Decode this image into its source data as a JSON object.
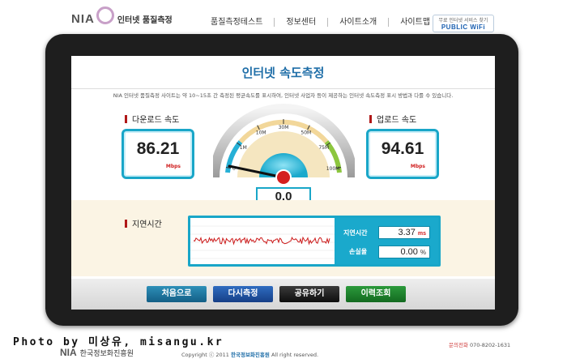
{
  "header": {
    "logo_text": "NIA",
    "logo_subtitle": "인터넷 품질측정",
    "nav": [
      {
        "label": "품질측정테스트"
      },
      {
        "label": "정보센터"
      },
      {
        "label": "사이트소개"
      },
      {
        "label": "사이트맵"
      }
    ],
    "public_wifi": {
      "top_text": "무료 인터넷 서비스 찾기",
      "label": "PUBLIC WiFi"
    }
  },
  "main": {
    "title": "인터넷 속도측정",
    "description": "NIA 인터넷 품질측정 사이트는 약 10~15초 간 측정된 평균속도를 표시하여, 인터넷 사업자 등이 제공하는 인터넷 속도측정 표시 방법과 다를 수 있습니다."
  },
  "download": {
    "label": "다운로드 속도",
    "value": "86.21",
    "unit": "Mbps"
  },
  "upload": {
    "label": "업로드 속도",
    "value": "94.61",
    "unit": "Mbps"
  },
  "gauge": {
    "ticks": [
      {
        "label": "0",
        "value": 0
      },
      {
        "label": "1M",
        "value": 1
      },
      {
        "label": "10M",
        "value": 10
      },
      {
        "label": "30M",
        "value": 30
      },
      {
        "label": "50M",
        "value": 50
      },
      {
        "label": "75M",
        "value": 75
      },
      {
        "label": "100M",
        "value": 100
      }
    ],
    "readout": "0.0",
    "current_value": 0
  },
  "latency": {
    "section_label": "지연시간",
    "latency_label": "지연시간",
    "latency_value": "3.37",
    "latency_unit": "ms",
    "loss_label": "손실율",
    "loss_value": "0.00",
    "loss_unit": "%"
  },
  "buttons": {
    "home": "처음으로",
    "retest": "다시측정",
    "share": "공유하기",
    "history": "이력조회"
  },
  "watermark": "Photo by 미상유, misangu.kr",
  "footer": {
    "logo_text": "NIA",
    "org": "한국정보화진흥원",
    "copyright_prefix": "Copyright ⓒ 2011",
    "copyright_org": "한국정보화진흥원",
    "copyright_suffix": "All right reserved.",
    "contact_label": "문의전화",
    "contact_phone": "070-8202-1631"
  },
  "colors": {
    "accent": "#19a6c8",
    "title_blue": "#1f6ea8",
    "unit_red": "#d02020",
    "graph_line": "#cc1a1a"
  }
}
